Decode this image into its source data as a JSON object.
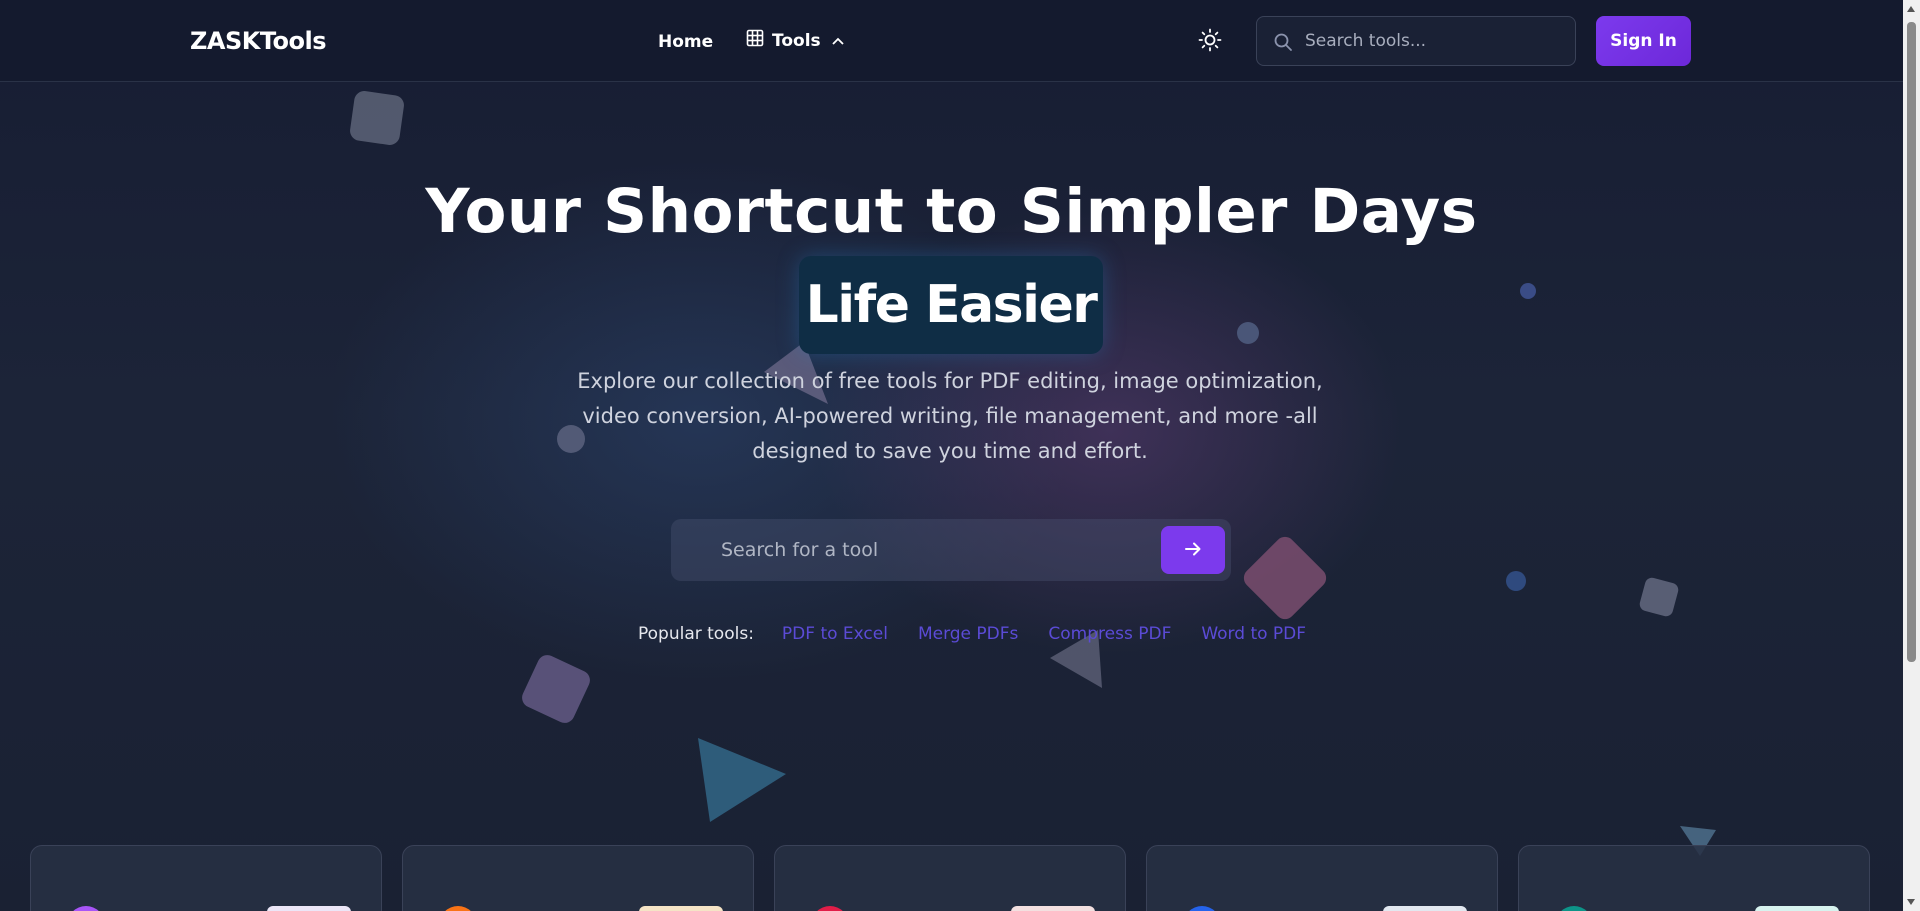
{
  "nav": {
    "logo": "ZASKTools",
    "home_label": "Home",
    "tools_label": "Tools",
    "search_placeholder": "Search tools...",
    "signin_label": "Sign In"
  },
  "hero": {
    "title": "Your Shortcut to Simpler Days",
    "badge": "Life Easier",
    "subtitle": "Explore our collection of free tools for PDF editing, image optimization, video conversion, AI-powered writing, file management, and more -all designed to save you time and effort.",
    "search_placeholder": "Search for a tool"
  },
  "popular": {
    "label": "Popular tools:",
    "links": [
      "PDF to Excel",
      "Merge PDFs",
      "Compress PDF",
      "Word to PDF"
    ]
  },
  "colors": {
    "accent": "#7c3aed",
    "link": "#5b4bd6",
    "background": "#171d33",
    "badge_bg": "#0f2d45"
  },
  "icons": {
    "tools": "grid-icon",
    "tools_caret": "chevron-up-icon",
    "theme": "sun-icon",
    "search": "search-icon",
    "go": "arrow-right-icon"
  }
}
